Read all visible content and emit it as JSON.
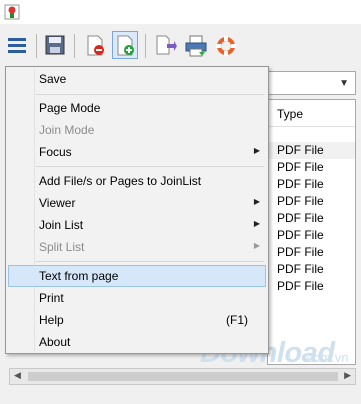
{
  "menu": {
    "items": [
      {
        "label": "Save",
        "enabled": true
      },
      {
        "label": "Page Mode",
        "enabled": true
      },
      {
        "label": "Join Mode",
        "enabled": false
      },
      {
        "label": "Focus",
        "enabled": true,
        "submenu": true
      },
      {
        "label": "Add File/s or Pages to JoinList",
        "enabled": true
      },
      {
        "label": "Viewer",
        "enabled": true,
        "submenu": true
      },
      {
        "label": "Join List",
        "enabled": true,
        "submenu": true
      },
      {
        "label": "Split List",
        "enabled": false,
        "submenu": true
      },
      {
        "label": "Text from page",
        "enabled": true,
        "highlighted": true
      },
      {
        "label": "Print",
        "enabled": true
      },
      {
        "label": "Help",
        "enabled": true,
        "shortcut": "(F1)"
      },
      {
        "label": "About",
        "enabled": true
      }
    ]
  },
  "file_list": {
    "column_header": "Type",
    "rows": [
      "PDF File",
      "PDF File",
      "PDF File",
      "PDF File",
      "PDF File",
      "PDF File",
      "PDF File",
      "PDF File",
      "PDF File"
    ]
  },
  "watermark": {
    "text": "Download",
    "suffix": ".com.vn"
  },
  "colors": {
    "highlight": "#d5e7f8",
    "highlight_border": "#9bc4ea",
    "disabled_text": "#8c8c8c",
    "watermark": "#cfe0ef"
  },
  "toolbar": {
    "icons": [
      "hamburger-menu-icon",
      "save-icon",
      "remove-page-icon",
      "add-page-icon",
      "export-page-icon",
      "print-icon",
      "help-lifebuoy-icon"
    ]
  }
}
